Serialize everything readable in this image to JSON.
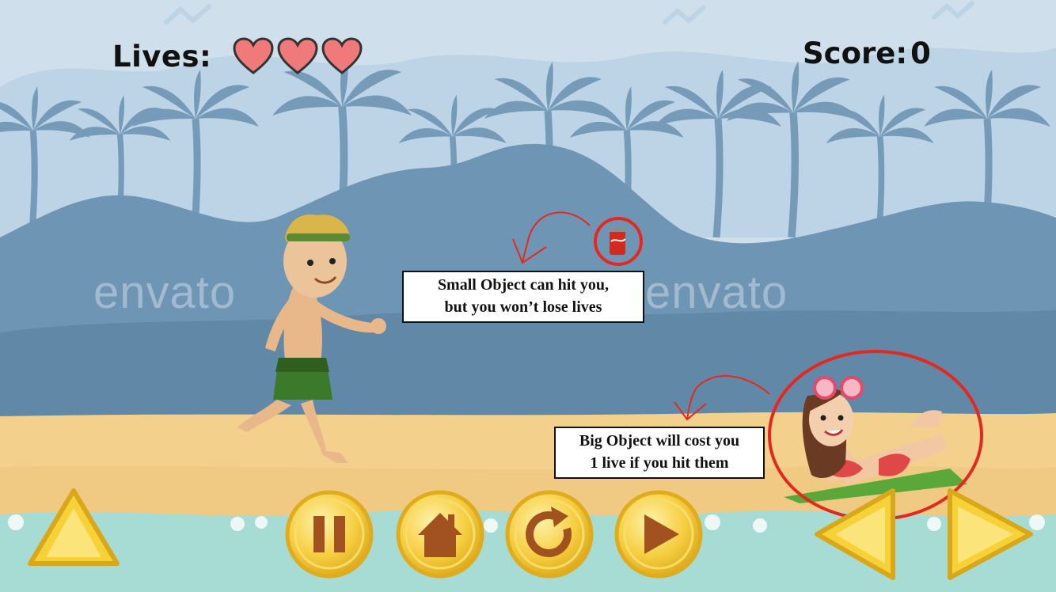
{
  "hud": {
    "lives_label": "Lives:",
    "lives_remaining": 3,
    "score_label": "Score:",
    "score_value": "0"
  },
  "watermark": "envato",
  "callouts": {
    "small": {
      "line1": "Small Object can hit you,",
      "line2": "but you won’t lose lives"
    },
    "big": {
      "line1": "Big Object will cost you",
      "line2": "1 live if you hit them"
    }
  },
  "colors": {
    "sky": "#c9dcea",
    "mountains": "#6f95b5",
    "sand": "#f3d089",
    "sea": "#9fd9d2",
    "heart": "#f07a7a",
    "button_gold": "#f2c94c",
    "button_icon": "#a2521e",
    "annotation": "#e5281e"
  },
  "controls": {
    "icons": [
      "jump-icon",
      "pause-icon",
      "home-icon",
      "restart-icon",
      "play-icon",
      "move-left-icon",
      "move-right-icon"
    ]
  }
}
